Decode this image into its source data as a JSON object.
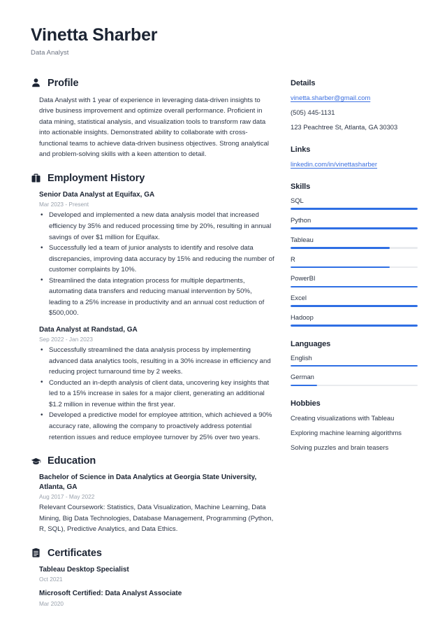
{
  "header": {
    "full_name": "Vinetta Sharber",
    "job_title": "Data Analyst"
  },
  "theme": {
    "accent": "#2f6fe4",
    "link": "#3b6fe0",
    "heading": "#1c2433",
    "text": "#2b3445",
    "muted": "#9aa2ad",
    "track": "#e9ebee",
    "background": "#ffffff"
  },
  "main": {
    "profile": {
      "icon": "user-icon",
      "title": "Profile",
      "text": "Data Analyst with 1 year of experience in leveraging data-driven insights to drive business improvement and optimize overall performance. Proficient in data mining, statistical analysis, and visualization tools to transform raw data into actionable insights. Demonstrated ability to collaborate with cross-functional teams to achieve data-driven business objectives. Strong analytical and problem-solving skills with a keen attention to detail."
    },
    "employment": {
      "icon": "briefcase-icon",
      "title": "Employment History",
      "entries": [
        {
          "title": "Senior Data Analyst at Equifax, GA",
          "date": "Mar 2023 - Present",
          "bullets": [
            "Developed and implemented a new data analysis model that increased efficiency by 35% and reduced processing time by 20%, resulting in annual savings of over $1 million for Equifax.",
            "Successfully led a team of junior analysts to identify and resolve data discrepancies, improving data accuracy by 15% and reducing the number of customer complaints by 10%.",
            "Streamlined the data integration process for multiple departments, automating data transfers and reducing manual intervention by 50%, leading to a 25% increase in productivity and an annual cost reduction of $500,000."
          ]
        },
        {
          "title": "Data Analyst at Randstad, GA",
          "date": "Sep 2022 - Jan 2023",
          "bullets": [
            "Successfully streamlined the data analysis process by implementing advanced data analytics tools, resulting in a 30% increase in efficiency and reducing project turnaround time by 2 weeks.",
            "Conducted an in-depth analysis of client data, uncovering key insights that led to a 15% increase in sales for a major client, generating an additional $1.2 million in revenue within the first year.",
            "Developed a predictive model for employee attrition, which achieved a 90% accuracy rate, allowing the company to proactively address potential retention issues and reduce employee turnover by 25% over two years."
          ]
        }
      ]
    },
    "education": {
      "icon": "graduation-cap-icon",
      "title": "Education",
      "entries": [
        {
          "title": "Bachelor of Science in Data Analytics at Georgia State University, Atlanta, GA",
          "date": "Aug 2017 - May 2022",
          "description": "Relevant Coursework: Statistics, Data Visualization, Machine Learning, Data Mining, Big Data Technologies, Database Management, Programming (Python, R, SQL), Predictive Analytics, and Data Ethics."
        }
      ]
    },
    "certificates": {
      "icon": "clipboard-icon",
      "title": "Certificates",
      "entries": [
        {
          "title": "Tableau Desktop Specialist",
          "date": "Oct 2021"
        },
        {
          "title": "Microsoft Certified: Data Analyst Associate",
          "date": "Mar 2020"
        }
      ]
    }
  },
  "sidebar": {
    "details": {
      "title": "Details",
      "email": "vinetta.sharber@gmail.com",
      "phone": "(505) 445-1131",
      "address": "123 Peachtree St, Atlanta, GA 30303"
    },
    "links": {
      "title": "Links",
      "items": [
        {
          "label": "linkedin.com/in/vinettasharber"
        }
      ]
    },
    "skills": {
      "title": "Skills",
      "items": [
        {
          "label": "SQL",
          "level": 100
        },
        {
          "label": "Python",
          "level": 100
        },
        {
          "label": "Tableau",
          "level": 78
        },
        {
          "label": "R",
          "level": 78
        },
        {
          "label": "PowerBI",
          "level": 100
        },
        {
          "label": "Excel",
          "level": 100
        },
        {
          "label": "Hadoop",
          "level": 100
        }
      ]
    },
    "languages": {
      "title": "Languages",
      "items": [
        {
          "label": "English",
          "level": 100
        },
        {
          "label": "German",
          "level": 21
        }
      ]
    },
    "hobbies": {
      "title": "Hobbies",
      "items": [
        {
          "label": "Creating visualizations with Tableau"
        },
        {
          "label": "Exploring machine learning algorithms"
        },
        {
          "label": "Solving puzzles and brain teasers"
        }
      ]
    }
  }
}
